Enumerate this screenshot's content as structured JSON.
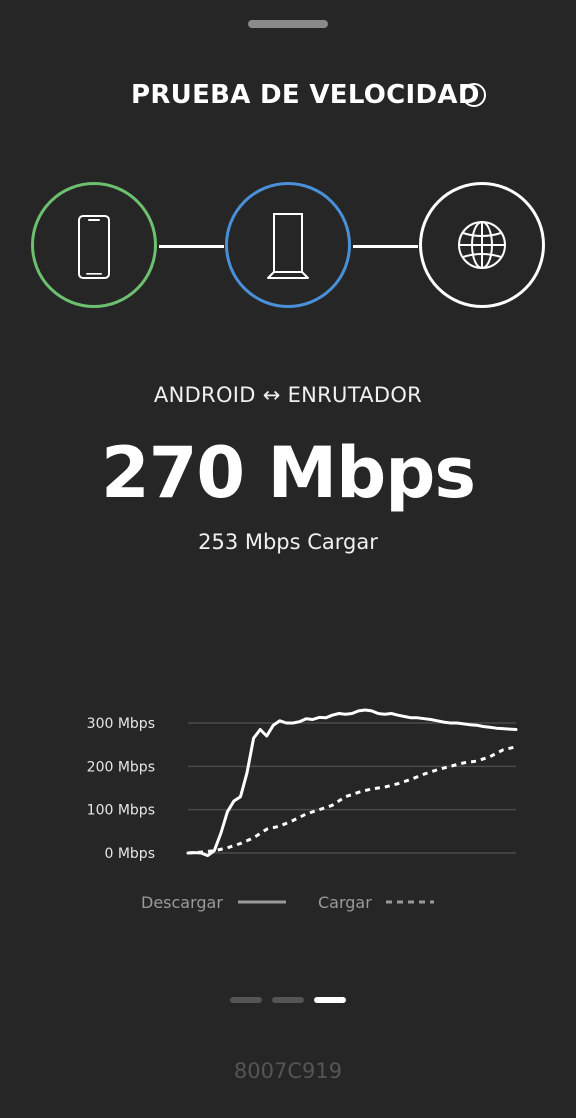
{
  "header": {
    "title": "PRUEBA DE VELOCIDAD",
    "info_icon": "info-icon"
  },
  "diagram": {
    "nodes": [
      {
        "icon": "phone-icon",
        "ring_color": "#6cc070"
      },
      {
        "icon": "router-icon",
        "ring_color": "#4a90d9"
      },
      {
        "icon": "globe-icon",
        "ring_color": "#ffffff"
      }
    ]
  },
  "result": {
    "route": "ANDROID ↔ ENRUTADOR",
    "download_speed": "270 Mbps",
    "upload_speed": "253 Mbps Cargar"
  },
  "chart_data": {
    "type": "line",
    "y_ticks": [
      "300 Mbps",
      "200 Mbps",
      "100 Mbps",
      "0 Mbps"
    ],
    "ylim": [
      0,
      300
    ],
    "grid": true,
    "legend_position": "bottom",
    "series": [
      {
        "name": "Descargar",
        "style": "solid",
        "x": [
          0,
          1,
          2,
          3,
          4,
          5,
          6,
          7,
          8,
          9,
          10,
          11,
          12,
          13,
          14,
          15,
          16,
          17,
          18,
          19,
          20,
          21,
          22,
          23,
          24,
          25,
          26,
          27,
          28,
          29,
          30,
          31,
          32,
          33,
          34,
          35,
          36,
          37,
          38,
          39,
          40,
          41,
          42,
          43,
          44,
          45,
          46,
          47,
          48,
          49,
          50
        ],
        "values": [
          0,
          1,
          0,
          -6,
          5,
          45,
          95,
          120,
          130,
          185,
          265,
          285,
          270,
          295,
          305,
          300,
          300,
          303,
          310,
          308,
          313,
          312,
          318,
          322,
          320,
          322,
          328,
          330,
          328,
          322,
          320,
          322,
          318,
          315,
          312,
          312,
          310,
          308,
          305,
          302,
          300,
          300,
          298,
          296,
          295,
          292,
          290,
          288,
          287,
          286,
          285
        ]
      },
      {
        "name": "Cargar",
        "style": "dashed",
        "x": [
          0,
          2,
          4,
          6,
          8,
          10,
          12,
          14,
          16,
          18,
          20,
          22,
          24,
          26,
          28,
          30,
          32,
          34,
          36,
          38,
          40,
          42,
          44,
          46,
          48,
          50
        ],
        "values": [
          0,
          2,
          5,
          12,
          22,
          35,
          55,
          62,
          75,
          90,
          100,
          110,
          130,
          140,
          148,
          152,
          160,
          170,
          182,
          192,
          200,
          208,
          212,
          222,
          238,
          245
        ]
      }
    ]
  },
  "pagination": {
    "pages": 3,
    "current": 3
  },
  "device_id": "8007C919"
}
